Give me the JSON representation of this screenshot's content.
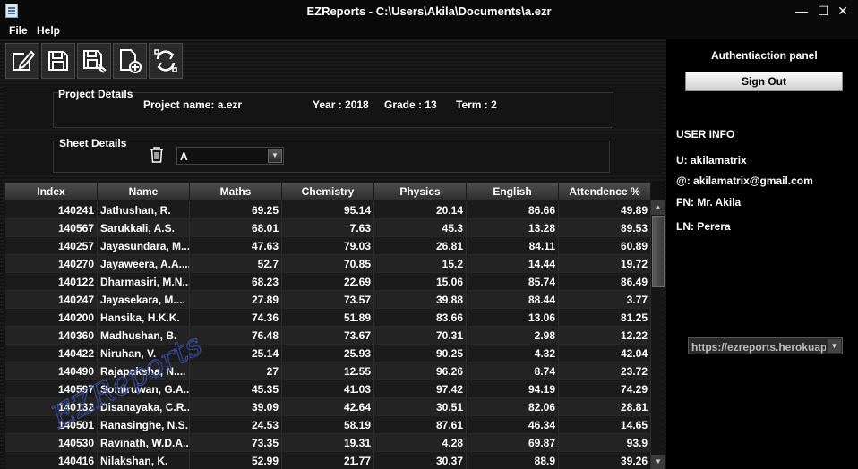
{
  "window": {
    "title": "EZReports - C:\\Users\\Akila\\Documents\\a.ezr",
    "minimize": "—",
    "maximize": "☐",
    "close": "✕"
  },
  "menu": [
    "File",
    "Help"
  ],
  "toolbar": [
    "edit-icon",
    "save-icon",
    "save-as-icon",
    "new-sheet-icon",
    "refresh-icon"
  ],
  "project": {
    "heading": "Project Details",
    "name": "Project name: a.ezr",
    "year": "Year : 2018",
    "grade": "Grade : 13",
    "term": "Term : 2"
  },
  "sheet": {
    "heading": "Sheet Details",
    "selected": "A"
  },
  "table": {
    "columns": [
      "Index",
      "Name",
      "Maths",
      "Chemistry",
      "Physics",
      "English",
      "Attendence %"
    ],
    "rows": [
      [
        "140241",
        "Jathushan, R.",
        "69.25",
        "95.14",
        "20.14",
        "86.66",
        "49.89"
      ],
      [
        "140567",
        "Sarukkali, A.S.",
        "68.01",
        "7.63",
        "45.3",
        "13.28",
        "89.53"
      ],
      [
        "140257",
        "Jayasundara, M...",
        "47.63",
        "79.03",
        "26.81",
        "84.11",
        "60.89"
      ],
      [
        "140270",
        "Jayaweera, A.A....",
        "52.7",
        "70.85",
        "15.2",
        "14.44",
        "19.72"
      ],
      [
        "140122",
        "Dharmasiri, M.N...",
        "68.23",
        "22.69",
        "15.06",
        "85.74",
        "86.49"
      ],
      [
        "140247",
        "Jayasekara, M....",
        "27.89",
        "73.57",
        "39.88",
        "88.44",
        "3.77"
      ],
      [
        "140200",
        "Hansika, H.K.K.",
        "74.36",
        "51.89",
        "83.66",
        "13.06",
        "81.25"
      ],
      [
        "140360",
        "Madhushan, B.",
        "76.48",
        "73.67",
        "70.31",
        "2.98",
        "12.22"
      ],
      [
        "140422",
        "Niruhan, V.",
        "25.14",
        "25.93",
        "90.25",
        "4.32",
        "42.04"
      ],
      [
        "140490",
        "Rajapaksha, N....",
        "27",
        "12.55",
        "96.26",
        "8.74",
        "23.72"
      ],
      [
        "140597",
        "Somiruwan, G.A...",
        "45.35",
        "41.03",
        "97.42",
        "94.19",
        "74.29"
      ],
      [
        "140132",
        "Disanayaka, C.R...",
        "39.09",
        "42.64",
        "30.51",
        "82.06",
        "28.81"
      ],
      [
        "140501",
        "Ranasinghe, N.S.",
        "24.53",
        "58.19",
        "87.61",
        "46.34",
        "14.65"
      ],
      [
        "140530",
        "Ravinath, W.D.A...",
        "73.35",
        "19.31",
        "4.28",
        "69.87",
        "93.9"
      ],
      [
        "140416",
        "Nilakshan, K.",
        "52.99",
        "21.77",
        "30.37",
        "88.9",
        "39.26"
      ]
    ]
  },
  "auth": {
    "heading": "Authentiaction panel",
    "signout": "Sign Out",
    "user_info": "USER INFO",
    "username": "U: akilamatrix",
    "email": "@: akilamatrix@gmail.com",
    "first_name": "FN: Mr. Akila",
    "last_name": "LN: Perera",
    "server": "https://ezreports.herokuapp.com"
  },
  "watermark": "EZReports"
}
